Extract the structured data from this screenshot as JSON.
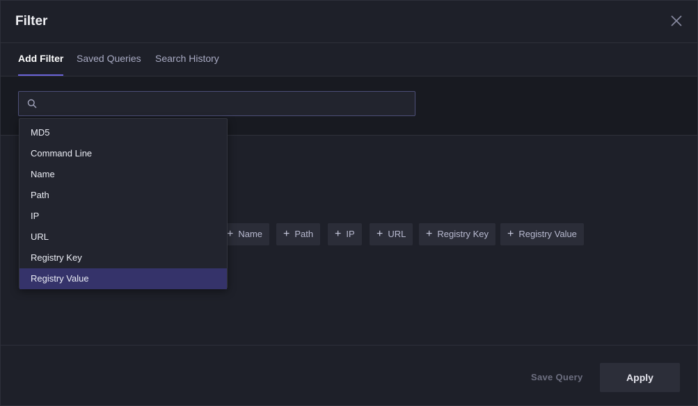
{
  "dialog": {
    "title": "Filter"
  },
  "tabs": [
    {
      "label": "Add Filter",
      "active": true
    },
    {
      "label": "Saved Queries",
      "active": false
    },
    {
      "label": "Search History",
      "active": false
    }
  ],
  "search": {
    "value": "",
    "placeholder": ""
  },
  "dropdown": {
    "items": [
      {
        "label": "MD5"
      },
      {
        "label": "Command Line"
      },
      {
        "label": "Name"
      },
      {
        "label": "Path"
      },
      {
        "label": "IP"
      },
      {
        "label": "URL"
      },
      {
        "label": "Registry Key"
      },
      {
        "label": "Registry Value",
        "selected": true
      }
    ]
  },
  "chips": [
    {
      "label": "Name"
    },
    {
      "label": "Path"
    },
    {
      "label": "IP"
    },
    {
      "label": "URL"
    },
    {
      "label": "Registry Key"
    },
    {
      "label": "Registry Value"
    }
  ],
  "footer": {
    "save_query_label": "Save Query",
    "apply_label": "Apply"
  },
  "colors": {
    "accent": "#6b63d9",
    "selected_row": "#35336a",
    "background": "#1e2029"
  }
}
